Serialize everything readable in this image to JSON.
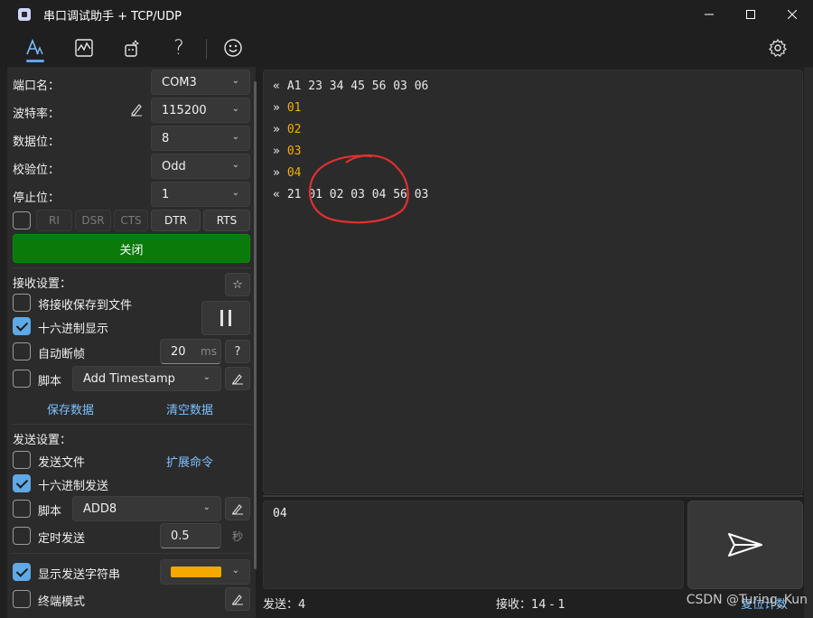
{
  "window": {
    "title": "串口调试助手 + TCP/UDP",
    "controls": [
      "minimize-icon",
      "maximize-icon",
      "close-icon"
    ]
  },
  "toolbar": {
    "icons": [
      "serial-icon",
      "chart-icon",
      "magic-icon",
      "help-icon",
      "smile-icon",
      "settings-icon"
    ],
    "help_glyph": "?"
  },
  "serial": {
    "port_label": "端口名：",
    "port_value": "COM3",
    "baud_label": "波特率：",
    "baud_value": "115200",
    "databits_label": "数据位：",
    "databits_value": "8",
    "parity_label": "校验位：",
    "parity_value": "Odd",
    "stopbits_label": "停止位：",
    "stopbits_value": "1",
    "signals": [
      "RI",
      "DSR",
      "CTS",
      "DTR",
      "RTS"
    ],
    "close_label": "关闭"
  },
  "receive_settings": {
    "heading": "接收设置：",
    "save_to_file": "将接收保存到文件",
    "hex_display": "十六进制显示",
    "auto_frame": "自动断帧",
    "auto_frame_value": "20",
    "auto_frame_unit": "ms",
    "help": "?",
    "script_label": "脚本",
    "script_value": "Add Timestamp",
    "save_data": "保存数据",
    "clear_data": "清空数据",
    "star": "☆"
  },
  "send_settings": {
    "heading": "发送设置：",
    "send_file": "发送文件",
    "extend_cmd": "扩展命令",
    "hex_send": "十六进制发送",
    "script_label": "脚本",
    "script_value": "ADD8",
    "timed_send": "定时发送",
    "timed_value": "0.5",
    "timed_unit": "秒",
    "show_send": "显示发送字符串",
    "show_send_color": "#f5a800",
    "terminal_mode": "终端模式"
  },
  "receive_log": [
    {
      "dir": "«",
      "payload": "A1 23 34 45 56 03 06",
      "kind": "recv"
    },
    {
      "dir": "»",
      "payload": "01",
      "kind": "sent"
    },
    {
      "dir": "»",
      "payload": "02",
      "kind": "sent"
    },
    {
      "dir": "»",
      "payload": "03",
      "kind": "sent"
    },
    {
      "dir": "»",
      "payload": "04",
      "kind": "sent"
    },
    {
      "dir": "«",
      "payload": "21 01 02 03 04 56 03",
      "kind": "recv"
    }
  ],
  "send_box": {
    "text": "04"
  },
  "status": {
    "sent": "发送：4",
    "received": "接收：14 - 1",
    "reset": "复位计数"
  },
  "watermark": "CSDN @Turing_Kun",
  "colors": {
    "accent": "#60a5fa",
    "close_button": "#0a7a0a",
    "sent_text": "#f0b000",
    "annotation": "#e03030"
  }
}
